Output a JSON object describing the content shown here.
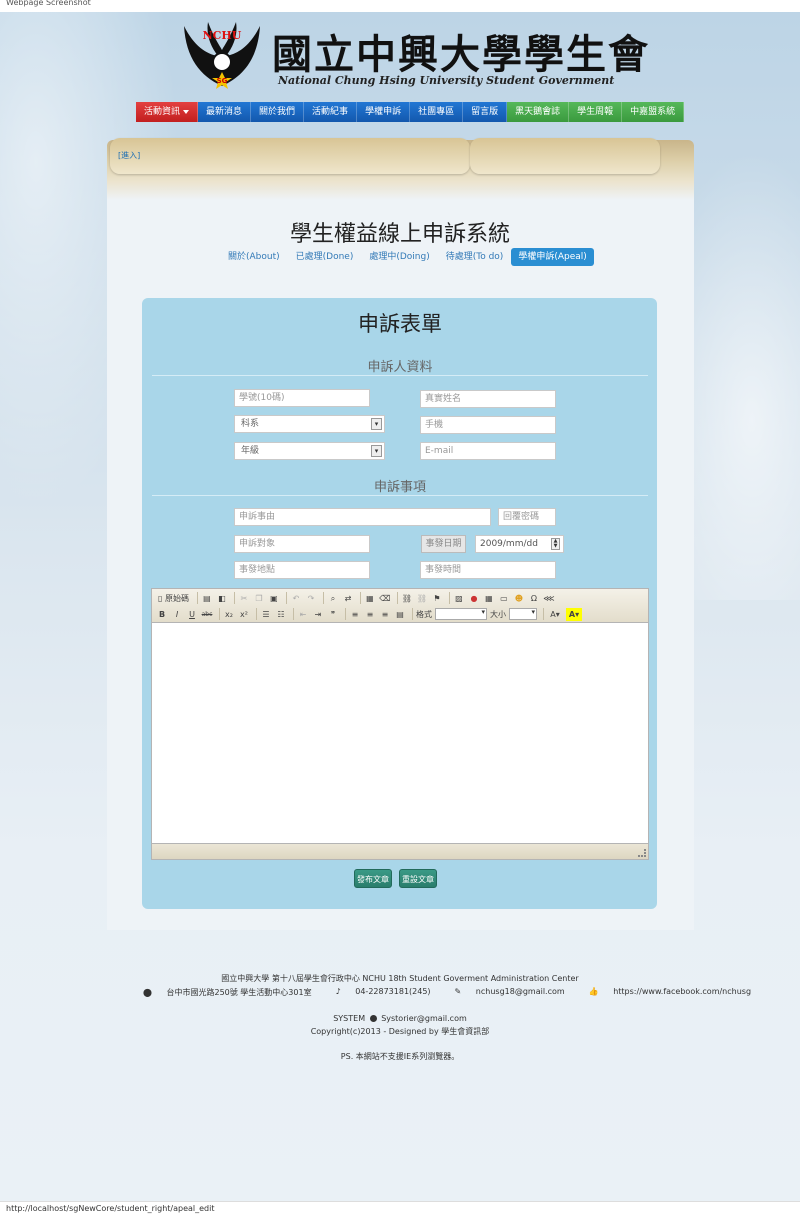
{
  "browser": {
    "tab_title": "Webpage Screenshot",
    "status_url": "http://localhost/sgNewCore/student_right/apeal_edit"
  },
  "brand": {
    "emblem_text": "NCHU",
    "emblem_badge": "SG",
    "title": "國立中興大學學生會",
    "subtitle": "National Chung Hsing University Student Government"
  },
  "nav": {
    "items": [
      {
        "label": "活動資訊",
        "color": "#d32f2f"
      },
      {
        "label": "最新消息",
        "color": "#1a66c0"
      },
      {
        "label": "關於我們",
        "color": "#1a66c0"
      },
      {
        "label": "活動紀事",
        "color": "#1a66c0"
      },
      {
        "label": "學權申訴",
        "color": "#1a66c0"
      },
      {
        "label": "社團專區",
        "color": "#1a66c0"
      },
      {
        "label": "留言版",
        "color": "#1a66c0"
      },
      {
        "label": "黑天鵝會誌",
        "color": "#43a047"
      },
      {
        "label": "學生周報",
        "color": "#43a047"
      },
      {
        "label": "中嘉盟系統",
        "color": "#43a047"
      }
    ]
  },
  "header": {
    "login_link": "[進入]"
  },
  "page": {
    "title": "學生權益線上申訴系統",
    "tabs": [
      {
        "label": "關於(About)"
      },
      {
        "label": "已處理(Done)"
      },
      {
        "label": "處理中(Doing)"
      },
      {
        "label": "待處理(To do)"
      },
      {
        "label": "學權申訴(Apeal)"
      }
    ]
  },
  "form": {
    "title": "申訴表單",
    "section_person": "申訴人資料",
    "student_id_placeholder": "學號(10碼)",
    "real_name_placeholder": "真實姓名",
    "department_selected": "科系",
    "phone_placeholder": "手機",
    "grade_selected": "年級",
    "email_placeholder": "E-mail",
    "section_matter": "申訴事項",
    "reason_placeholder": "申訴事由",
    "reply_password_placeholder": "回覆密碼",
    "target_placeholder": "申訴對象",
    "date_label": "事發日期",
    "date_value": "2009/mm/dd",
    "location_placeholder": "事發地點",
    "time_placeholder": "事發時間",
    "editor": {
      "source_label": "原始碼",
      "format_label": "格式",
      "size_label": "大小",
      "bold": "B",
      "italic": "I",
      "underline": "U",
      "strike": "abc",
      "subscript": "x₂",
      "superscript": "x²"
    },
    "submit_label": "發布文章",
    "reset_label": "重設文章"
  },
  "footer": {
    "org": "國立中興大學 第十八屆學生會行政中心   NCHU 18th Student Goverment Administration Center",
    "address": "台中市國光路250號 學生活動中心301室",
    "phone": "04-22873181(245)",
    "email": "nchusg18@gmail.com",
    "facebook": "https://www.facebook.com/nchusg",
    "system_label": "SYSTEM",
    "system_email": "Systorier@gmail.com",
    "copyright": "Copyright(c)2013 - Designed by 學生會資訊部",
    "note": "PS. 本網站不支援IE系列瀏覽器。"
  },
  "colors": {
    "panel": "#a9d6e9",
    "active_tab": "#2a8ed2",
    "button": "#2f8c78"
  }
}
